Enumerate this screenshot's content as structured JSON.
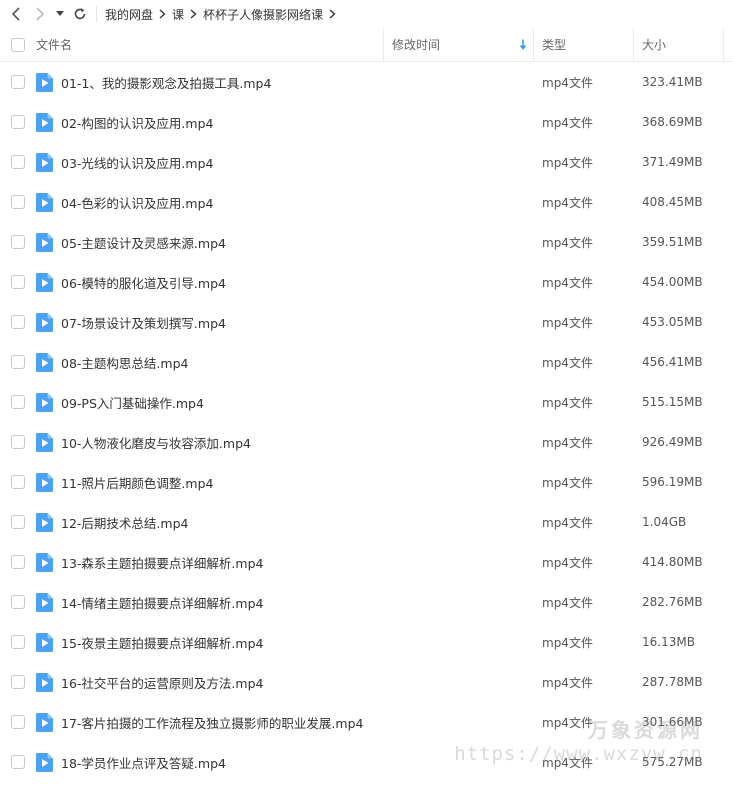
{
  "breadcrumb": {
    "items": [
      "我的网盘",
      "课",
      "杯杯子人像摄影网络课"
    ]
  },
  "columns": {
    "name": "文件名",
    "mtime": "修改时间",
    "type": "类型",
    "size": "大小"
  },
  "files": [
    {
      "name": "01-1、我的摄影观念及拍摄工具.mp4",
      "type": "mp4文件",
      "size": "323.41MB"
    },
    {
      "name": "02-构图的认识及应用.mp4",
      "type": "mp4文件",
      "size": "368.69MB"
    },
    {
      "name": "03-光线的认识及应用.mp4",
      "type": "mp4文件",
      "size": "371.49MB"
    },
    {
      "name": "04-色彩的认识及应用.mp4",
      "type": "mp4文件",
      "size": "408.45MB"
    },
    {
      "name": "05-主题设计及灵感来源.mp4",
      "type": "mp4文件",
      "size": "359.51MB"
    },
    {
      "name": "06-模特的服化道及引导.mp4",
      "type": "mp4文件",
      "size": "454.00MB"
    },
    {
      "name": "07-场景设计及策划撰写.mp4",
      "type": "mp4文件",
      "size": "453.05MB"
    },
    {
      "name": "08-主题构思总结.mp4",
      "type": "mp4文件",
      "size": "456.41MB"
    },
    {
      "name": "09-PS入门基础操作.mp4",
      "type": "mp4文件",
      "size": "515.15MB"
    },
    {
      "name": "10-人物液化磨皮与妆容添加.mp4",
      "type": "mp4文件",
      "size": "926.49MB"
    },
    {
      "name": "11-照片后期颜色调整.mp4",
      "type": "mp4文件",
      "size": "596.19MB"
    },
    {
      "name": "12-后期技术总结.mp4",
      "type": "mp4文件",
      "size": "1.04GB"
    },
    {
      "name": "13-森系主题拍摄要点详细解析.mp4",
      "type": "mp4文件",
      "size": "414.80MB"
    },
    {
      "name": "14-情绪主题拍摄要点详细解析.mp4",
      "type": "mp4文件",
      "size": "282.76MB"
    },
    {
      "name": "15-夜景主题拍摄要点详细解析.mp4",
      "type": "mp4文件",
      "size": "16.13MB"
    },
    {
      "name": "16-社交平台的运营原则及方法.mp4",
      "type": "mp4文件",
      "size": "287.78MB"
    },
    {
      "name": "17-客片拍摄的工作流程及独立摄影师的职业发展.mp4",
      "type": "mp4文件",
      "size": "301.66MB"
    },
    {
      "name": "18-学员作业点评及答疑.mp4",
      "type": "mp4文件",
      "size": "575.27MB"
    }
  ],
  "watermark": {
    "line1": "万象资源网",
    "line2": "https://www.wxzyw.cn"
  },
  "colors": {
    "accent": "#3b9cf0",
    "file_icon": "#4aa3f2"
  },
  "icons": {
    "back": "chevron-left-icon",
    "forward": "chevron-right-icon",
    "dropdown": "caret-down-icon",
    "refresh": "refresh-icon",
    "sort": "arrow-down-icon",
    "file": "video-file-icon"
  }
}
